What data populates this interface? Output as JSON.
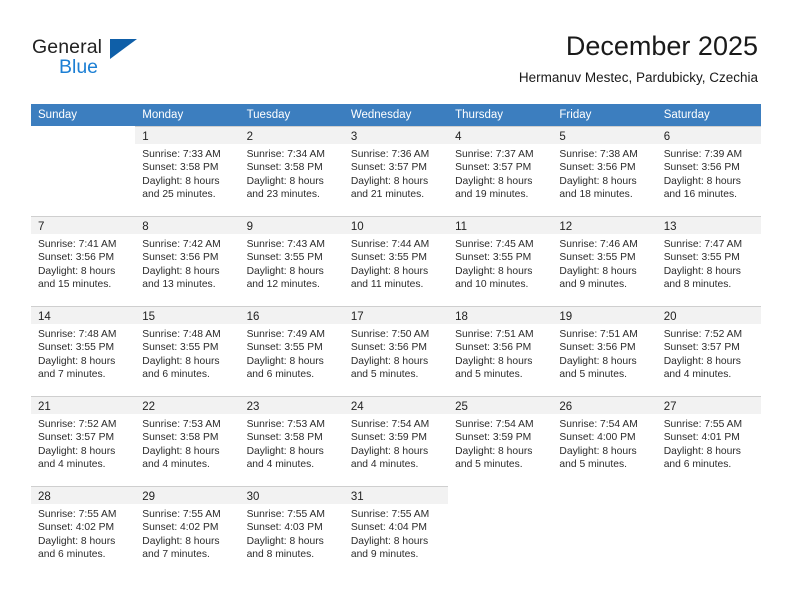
{
  "brand": {
    "name_top": "General",
    "name_bottom": "Blue",
    "triangle_color": "#0f5fa8",
    "blue_color": "#1c7fd4"
  },
  "header": {
    "title": "December 2025",
    "subtitle": "Hermanuv Mestec, Pardubicky, Czechia"
  },
  "theme": {
    "header_row_bg": "#3c7ebf",
    "header_row_text": "#ffffff",
    "daynum_bg": "#f2f2f2",
    "grid_line": "#cfcfcf"
  },
  "weekdays": [
    "Sunday",
    "Monday",
    "Tuesday",
    "Wednesday",
    "Thursday",
    "Friday",
    "Saturday"
  ],
  "weeks": [
    [
      {
        "empty": true
      },
      {
        "day": "1",
        "sunrise": "Sunrise: 7:33 AM",
        "sunset": "Sunset: 3:58 PM",
        "daylight1": "Daylight: 8 hours",
        "daylight2": "and 25 minutes."
      },
      {
        "day": "2",
        "sunrise": "Sunrise: 7:34 AM",
        "sunset": "Sunset: 3:58 PM",
        "daylight1": "Daylight: 8 hours",
        "daylight2": "and 23 minutes."
      },
      {
        "day": "3",
        "sunrise": "Sunrise: 7:36 AM",
        "sunset": "Sunset: 3:57 PM",
        "daylight1": "Daylight: 8 hours",
        "daylight2": "and 21 minutes."
      },
      {
        "day": "4",
        "sunrise": "Sunrise: 7:37 AM",
        "sunset": "Sunset: 3:57 PM",
        "daylight1": "Daylight: 8 hours",
        "daylight2": "and 19 minutes."
      },
      {
        "day": "5",
        "sunrise": "Sunrise: 7:38 AM",
        "sunset": "Sunset: 3:56 PM",
        "daylight1": "Daylight: 8 hours",
        "daylight2": "and 18 minutes."
      },
      {
        "day": "6",
        "sunrise": "Sunrise: 7:39 AM",
        "sunset": "Sunset: 3:56 PM",
        "daylight1": "Daylight: 8 hours",
        "daylight2": "and 16 minutes."
      }
    ],
    [
      {
        "day": "7",
        "sunrise": "Sunrise: 7:41 AM",
        "sunset": "Sunset: 3:56 PM",
        "daylight1": "Daylight: 8 hours",
        "daylight2": "and 15 minutes."
      },
      {
        "day": "8",
        "sunrise": "Sunrise: 7:42 AM",
        "sunset": "Sunset: 3:56 PM",
        "daylight1": "Daylight: 8 hours",
        "daylight2": "and 13 minutes."
      },
      {
        "day": "9",
        "sunrise": "Sunrise: 7:43 AM",
        "sunset": "Sunset: 3:55 PM",
        "daylight1": "Daylight: 8 hours",
        "daylight2": "and 12 minutes."
      },
      {
        "day": "10",
        "sunrise": "Sunrise: 7:44 AM",
        "sunset": "Sunset: 3:55 PM",
        "daylight1": "Daylight: 8 hours",
        "daylight2": "and 11 minutes."
      },
      {
        "day": "11",
        "sunrise": "Sunrise: 7:45 AM",
        "sunset": "Sunset: 3:55 PM",
        "daylight1": "Daylight: 8 hours",
        "daylight2": "and 10 minutes."
      },
      {
        "day": "12",
        "sunrise": "Sunrise: 7:46 AM",
        "sunset": "Sunset: 3:55 PM",
        "daylight1": "Daylight: 8 hours",
        "daylight2": "and 9 minutes."
      },
      {
        "day": "13",
        "sunrise": "Sunrise: 7:47 AM",
        "sunset": "Sunset: 3:55 PM",
        "daylight1": "Daylight: 8 hours",
        "daylight2": "and 8 minutes."
      }
    ],
    [
      {
        "day": "14",
        "sunrise": "Sunrise: 7:48 AM",
        "sunset": "Sunset: 3:55 PM",
        "daylight1": "Daylight: 8 hours",
        "daylight2": "and 7 minutes."
      },
      {
        "day": "15",
        "sunrise": "Sunrise: 7:48 AM",
        "sunset": "Sunset: 3:55 PM",
        "daylight1": "Daylight: 8 hours",
        "daylight2": "and 6 minutes."
      },
      {
        "day": "16",
        "sunrise": "Sunrise: 7:49 AM",
        "sunset": "Sunset: 3:55 PM",
        "daylight1": "Daylight: 8 hours",
        "daylight2": "and 6 minutes."
      },
      {
        "day": "17",
        "sunrise": "Sunrise: 7:50 AM",
        "sunset": "Sunset: 3:56 PM",
        "daylight1": "Daylight: 8 hours",
        "daylight2": "and 5 minutes."
      },
      {
        "day": "18",
        "sunrise": "Sunrise: 7:51 AM",
        "sunset": "Sunset: 3:56 PM",
        "daylight1": "Daylight: 8 hours",
        "daylight2": "and 5 minutes."
      },
      {
        "day": "19",
        "sunrise": "Sunrise: 7:51 AM",
        "sunset": "Sunset: 3:56 PM",
        "daylight1": "Daylight: 8 hours",
        "daylight2": "and 5 minutes."
      },
      {
        "day": "20",
        "sunrise": "Sunrise: 7:52 AM",
        "sunset": "Sunset: 3:57 PM",
        "daylight1": "Daylight: 8 hours",
        "daylight2": "and 4 minutes."
      }
    ],
    [
      {
        "day": "21",
        "sunrise": "Sunrise: 7:52 AM",
        "sunset": "Sunset: 3:57 PM",
        "daylight1": "Daylight: 8 hours",
        "daylight2": "and 4 minutes."
      },
      {
        "day": "22",
        "sunrise": "Sunrise: 7:53 AM",
        "sunset": "Sunset: 3:58 PM",
        "daylight1": "Daylight: 8 hours",
        "daylight2": "and 4 minutes."
      },
      {
        "day": "23",
        "sunrise": "Sunrise: 7:53 AM",
        "sunset": "Sunset: 3:58 PM",
        "daylight1": "Daylight: 8 hours",
        "daylight2": "and 4 minutes."
      },
      {
        "day": "24",
        "sunrise": "Sunrise: 7:54 AM",
        "sunset": "Sunset: 3:59 PM",
        "daylight1": "Daylight: 8 hours",
        "daylight2": "and 4 minutes."
      },
      {
        "day": "25",
        "sunrise": "Sunrise: 7:54 AM",
        "sunset": "Sunset: 3:59 PM",
        "daylight1": "Daylight: 8 hours",
        "daylight2": "and 5 minutes."
      },
      {
        "day": "26",
        "sunrise": "Sunrise: 7:54 AM",
        "sunset": "Sunset: 4:00 PM",
        "daylight1": "Daylight: 8 hours",
        "daylight2": "and 5 minutes."
      },
      {
        "day": "27",
        "sunrise": "Sunrise: 7:55 AM",
        "sunset": "Sunset: 4:01 PM",
        "daylight1": "Daylight: 8 hours",
        "daylight2": "and 6 minutes."
      }
    ],
    [
      {
        "day": "28",
        "sunrise": "Sunrise: 7:55 AM",
        "sunset": "Sunset: 4:02 PM",
        "daylight1": "Daylight: 8 hours",
        "daylight2": "and 6 minutes."
      },
      {
        "day": "29",
        "sunrise": "Sunrise: 7:55 AM",
        "sunset": "Sunset: 4:02 PM",
        "daylight1": "Daylight: 8 hours",
        "daylight2": "and 7 minutes."
      },
      {
        "day": "30",
        "sunrise": "Sunrise: 7:55 AM",
        "sunset": "Sunset: 4:03 PM",
        "daylight1": "Daylight: 8 hours",
        "daylight2": "and 8 minutes."
      },
      {
        "day": "31",
        "sunrise": "Sunrise: 7:55 AM",
        "sunset": "Sunset: 4:04 PM",
        "daylight1": "Daylight: 8 hours",
        "daylight2": "and 9 minutes."
      },
      {
        "empty": true
      },
      {
        "empty": true
      },
      {
        "empty": true
      }
    ]
  ]
}
